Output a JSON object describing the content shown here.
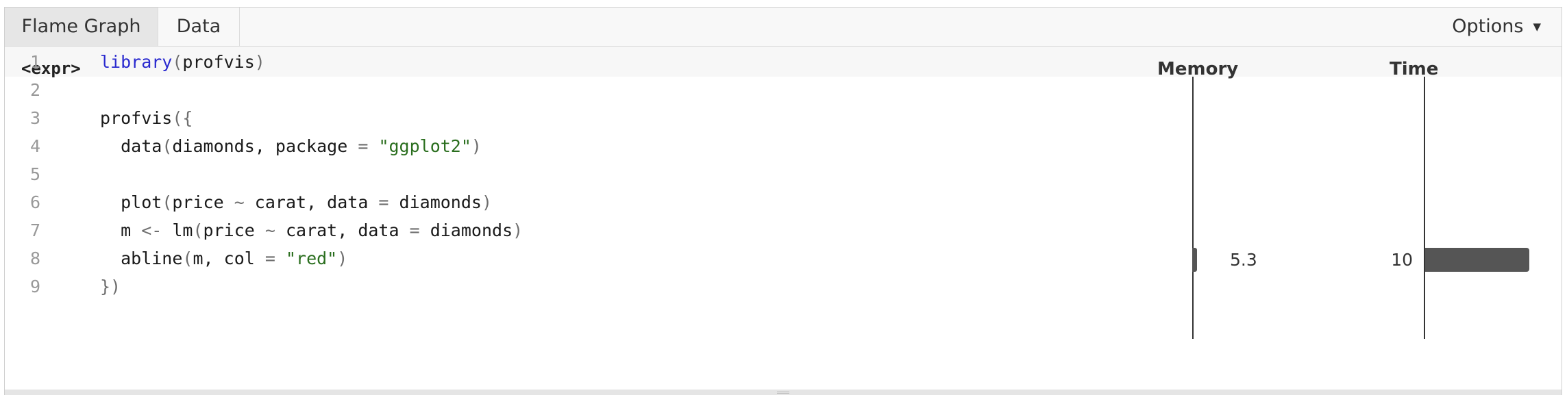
{
  "tabs": {
    "flame_graph": "Flame Graph",
    "data": "Data"
  },
  "options": {
    "label": "Options",
    "caret": "▼"
  },
  "header": {
    "expr": "<expr>",
    "memory": "Memory",
    "time": "Time"
  },
  "code_lines": [
    {
      "num": "1",
      "tokens": [
        {
          "t": "library",
          "c": "kw"
        },
        {
          "t": "(",
          "c": "pun"
        },
        {
          "t": "profvis"
        },
        {
          "t": ")",
          "c": "pun"
        }
      ]
    },
    {
      "num": "2",
      "tokens": []
    },
    {
      "num": "3",
      "tokens": [
        {
          "t": "profvis"
        },
        {
          "t": "({",
          "c": "pun"
        }
      ]
    },
    {
      "num": "4",
      "tokens": [
        {
          "t": "  data"
        },
        {
          "t": "(",
          "c": "pun"
        },
        {
          "t": "diamonds, package "
        },
        {
          "t": "=",
          "c": "pun"
        },
        {
          "t": " "
        },
        {
          "t": "\"ggplot2\"",
          "c": "str"
        },
        {
          "t": ")",
          "c": "pun"
        }
      ]
    },
    {
      "num": "5",
      "tokens": []
    },
    {
      "num": "6",
      "tokens": [
        {
          "t": "  plot"
        },
        {
          "t": "(",
          "c": "pun"
        },
        {
          "t": "price "
        },
        {
          "t": "~",
          "c": "pun"
        },
        {
          "t": " carat, data "
        },
        {
          "t": "=",
          "c": "pun"
        },
        {
          "t": " diamonds"
        },
        {
          "t": ")",
          "c": "pun"
        }
      ]
    },
    {
      "num": "7",
      "tokens": [
        {
          "t": "  m "
        },
        {
          "t": "<-",
          "c": "pun"
        },
        {
          "t": " lm"
        },
        {
          "t": "(",
          "c": "pun"
        },
        {
          "t": "price "
        },
        {
          "t": "~",
          "c": "pun"
        },
        {
          "t": " carat, data "
        },
        {
          "t": "=",
          "c": "pun"
        },
        {
          "t": " diamonds"
        },
        {
          "t": ")",
          "c": "pun"
        }
      ]
    },
    {
      "num": "8",
      "tokens": [
        {
          "t": "  abline"
        },
        {
          "t": "(",
          "c": "pun"
        },
        {
          "t": "m, col "
        },
        {
          "t": "=",
          "c": "pun"
        },
        {
          "t": " "
        },
        {
          "t": "\"red\"",
          "c": "str"
        },
        {
          "t": ")",
          "c": "pun"
        }
      ]
    },
    {
      "num": "9",
      "tokens": [
        {
          "t": "})",
          "c": "pun"
        }
      ]
    }
  ],
  "profile": {
    "line": "7",
    "memory_value": "5.3",
    "time_value": "10"
  },
  "colors": {
    "keyword": "#2a2acf",
    "string": "#2a6e1e",
    "bar": "#555555",
    "active_tab": "#e6e6e6"
  }
}
